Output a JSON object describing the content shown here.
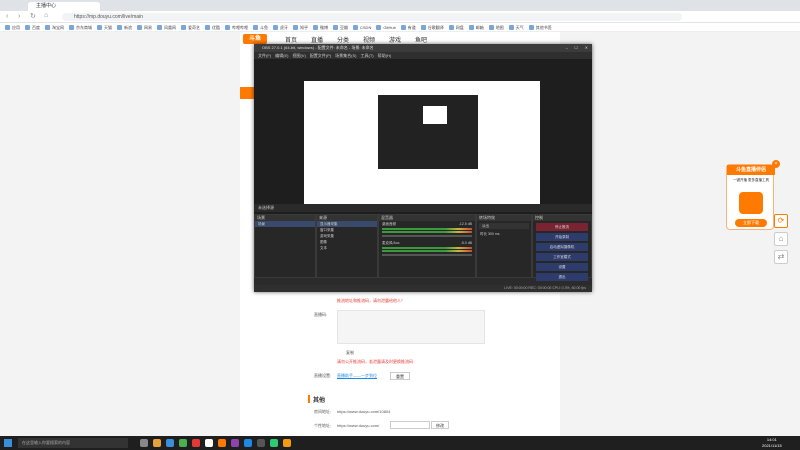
{
  "browser": {
    "tab_title": "主播中心",
    "url": "https://mp.douyu.com/live/main",
    "bookmarks": [
      "应用",
      "百度",
      "淘宝网",
      "京东商城",
      "天猫",
      "新浪",
      "网易",
      "凤凰网",
      "爱奇艺",
      "优酷",
      "哔哩哔哩",
      "斗鱼",
      "虎牙",
      "知乎",
      "微博",
      "豆瓣",
      "CSDN",
      "GitHub",
      "有道",
      "谷歌翻译",
      "网盘",
      "邮箱",
      "地图",
      "天气",
      "其他书签"
    ]
  },
  "douyu": {
    "logo": "斗鱼",
    "nav": [
      "首页",
      "直播",
      "分类",
      "视频",
      "游戏",
      "鱼吧"
    ]
  },
  "obs": {
    "title": "OBS 27.0.1 (64-bit, windows) - 配置文件: 未命名 - 场景: 未命名",
    "menu": [
      "文件(F)",
      "编辑(E)",
      "视图(V)",
      "配置文件(P)",
      "场景集合(S)",
      "工具(T)",
      "帮助(H)"
    ],
    "scene_bar": "未选择源",
    "scenes_header": "场景",
    "scene_item": "场景",
    "sources_header": "来源",
    "sources": [
      "显示器采集",
      "窗口采集",
      "游戏采集",
      "图像",
      "文本"
    ],
    "mixer_header": "混音器",
    "mixer": [
      {
        "name": "桌面音频",
        "db": "-12.5 dB"
      },
      {
        "name": "麦克风/Aux",
        "db": "-5.0 dB"
      }
    ],
    "transitions_header": "转场特效",
    "transition": "淡出",
    "duration_label": "时长",
    "duration": "300 ms",
    "controls_header": "控制",
    "controls": [
      "停止推流",
      "开始录制",
      "启动虚拟摄像机",
      "工作室模式",
      "设置",
      "退出"
    ],
    "status": "LIVE: 00:00:00    REC: 00:00:00    CPU: 0.3%, 60.00 fps"
  },
  "page": {
    "hint_red": "推流地址和推流码，请勿泄露给他人！",
    "live_code_label": "直播码:",
    "copy_hint": "复制",
    "red_note": "请勿公开推流码，若泄露请及时更换推流码",
    "help_label": "直播设置:",
    "help_link": "直播助手——一步到位",
    "help_btn": "重置",
    "section_title": "其他",
    "room_label": "房间地址:",
    "room_url": "https://www.douyu.com/10804",
    "personal_label": "个性地址:",
    "personal_url": "https://www.douyu.com/",
    "personal_btn": "修改"
  },
  "promo": {
    "title": "斗鱼直播伴侣",
    "text": "一键开播 更多直播工具",
    "btn": "立即下载"
  },
  "taskbar": {
    "search": "在这里输入你要搜索的内容",
    "time": "14:01",
    "date": "2021/11/15"
  }
}
